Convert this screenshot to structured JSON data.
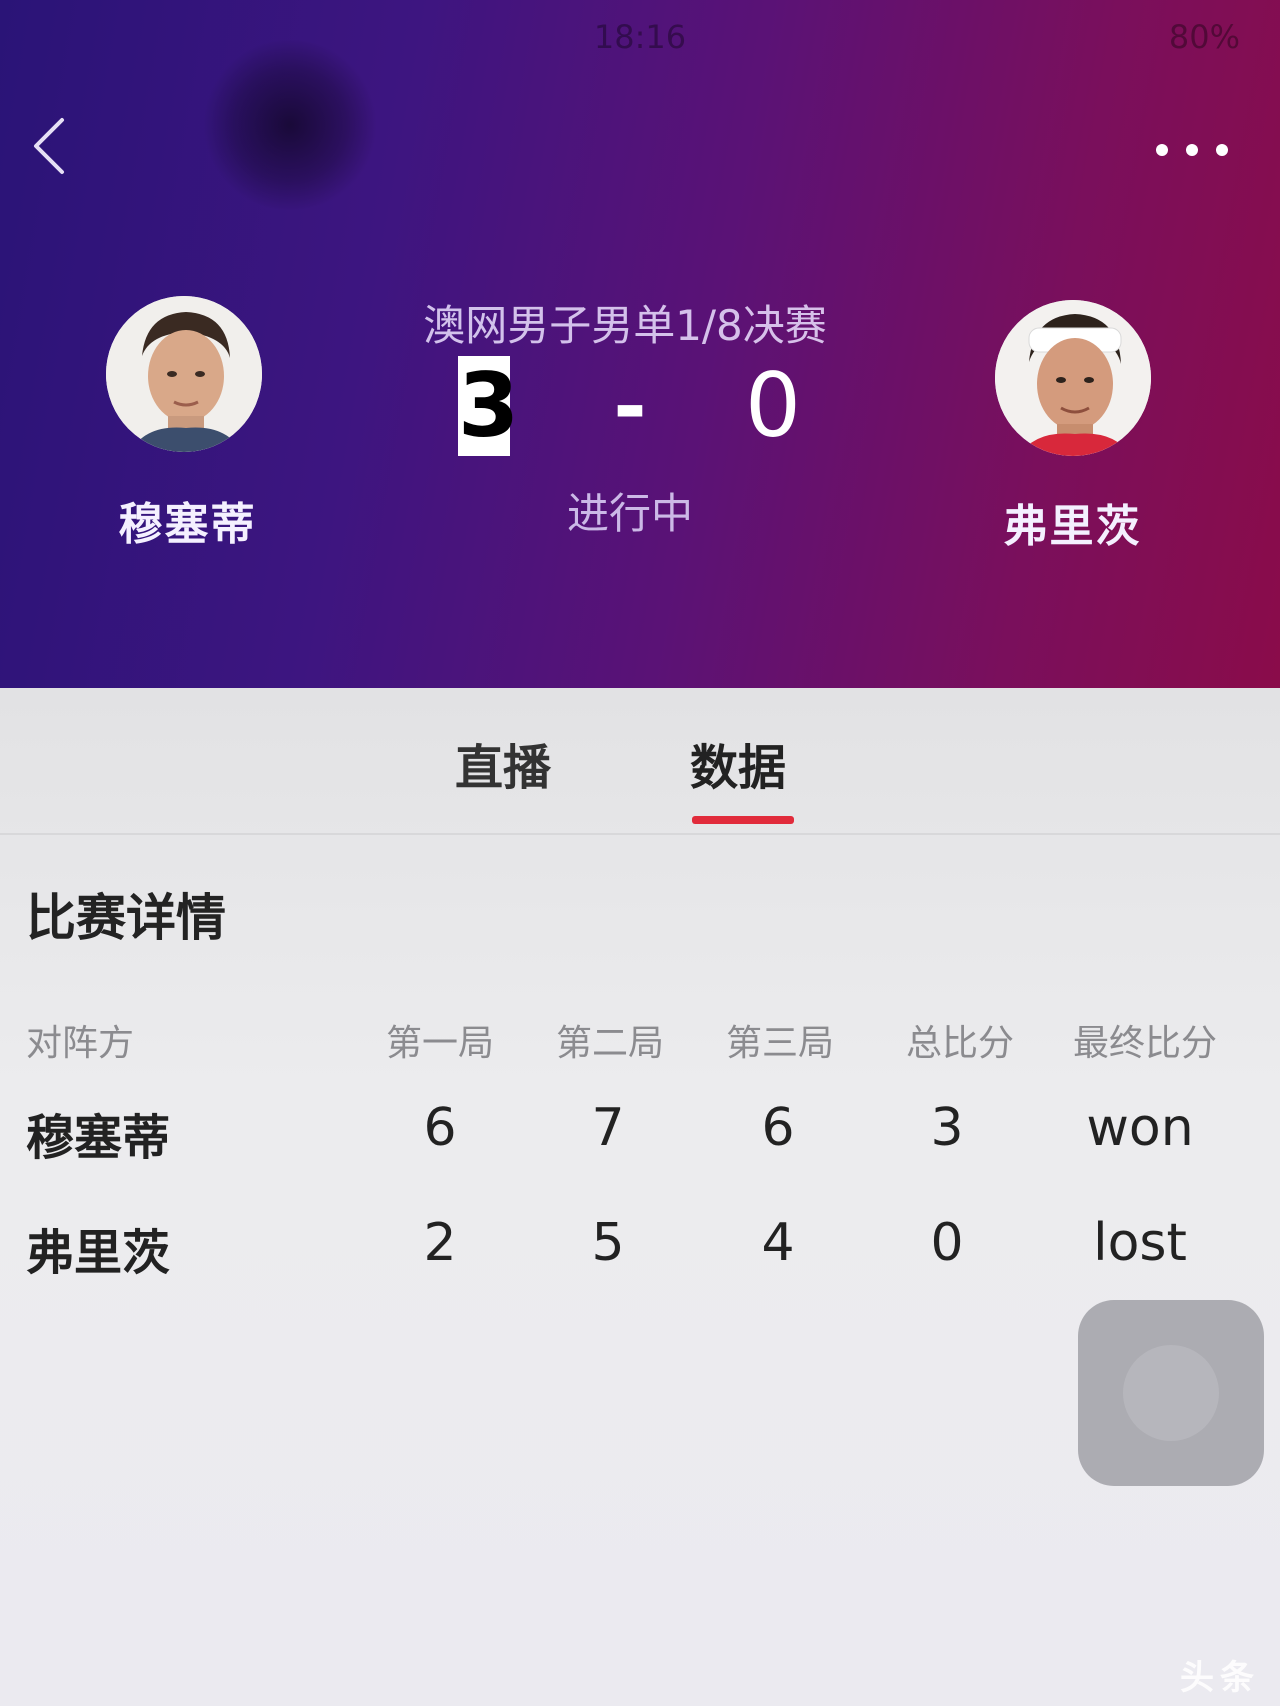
{
  "status_bar": {
    "time": "18:16",
    "battery": "80%"
  },
  "header": {
    "match_title": "澳网男子男单1/8决赛",
    "score": {
      "home": "3",
      "separator": "-",
      "away": "0"
    },
    "match_status": "进行中",
    "players": {
      "left": "穆塞蒂",
      "right": "弗里茨"
    }
  },
  "tabs": [
    {
      "label": "直播",
      "active": false
    },
    {
      "label": "数据",
      "active": true
    }
  ],
  "details": {
    "title": "比赛详情",
    "columns": [
      "对阵方",
      "第一局",
      "第二局",
      "第三局",
      "总比分",
      "最终比分"
    ],
    "rows": [
      {
        "name": "穆塞蒂",
        "set1": "6",
        "set2": "7",
        "set3": "6",
        "total": "3",
        "result": "won"
      },
      {
        "name": "弗里茨",
        "set1": "2",
        "set2": "5",
        "set3": "4",
        "total": "0",
        "result": "lost"
      }
    ]
  },
  "watermark": "头条",
  "colors": {
    "accent": "#e12b3b",
    "header_start": "#2a1477",
    "header_end": "#8a0c4a"
  }
}
